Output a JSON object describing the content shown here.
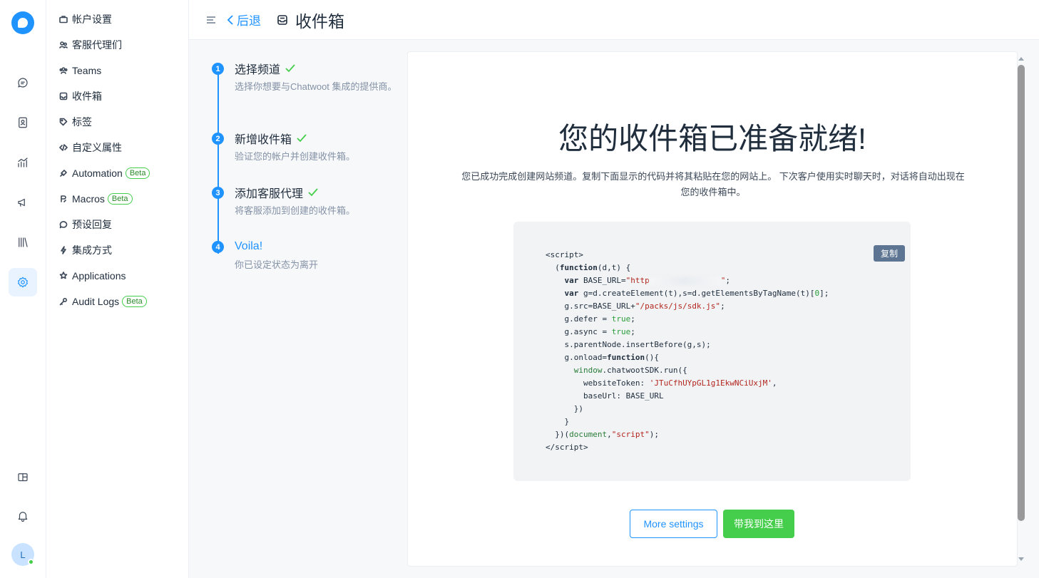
{
  "rail": {
    "avatar_initial": "L",
    "icons": [
      "conversations-icon",
      "contacts-icon",
      "reports-icon",
      "campaigns-icon",
      "library-icon",
      "settings-icon",
      "dashboard-apps-icon",
      "notifications-icon"
    ]
  },
  "sidebar": {
    "items": [
      {
        "label": "帐户设置",
        "icon": "briefcase-icon"
      },
      {
        "label": "客服代理们",
        "icon": "people-icon"
      },
      {
        "label": "Teams",
        "icon": "team-icon"
      },
      {
        "label": "收件箱",
        "icon": "inbox-icon"
      },
      {
        "label": "标签",
        "icon": "tag-icon"
      },
      {
        "label": "自定义属性",
        "icon": "code-icon"
      },
      {
        "label": "Automation",
        "icon": "automation-icon",
        "badge": "Beta"
      },
      {
        "label": "Macros",
        "icon": "macro-icon",
        "badge": "Beta"
      },
      {
        "label": "预设回复",
        "icon": "chat-icon"
      },
      {
        "label": "集成方式",
        "icon": "flash-icon"
      },
      {
        "label": "Applications",
        "icon": "star-icon"
      },
      {
        "label": "Audit Logs",
        "icon": "key-icon",
        "badge": "Beta"
      }
    ]
  },
  "header": {
    "back_label": "后退",
    "title": "收件箱"
  },
  "steps": [
    {
      "num": "1",
      "title": "选择频道",
      "desc": "选择你想要与Chatwoot 集成的提供商。",
      "done": true
    },
    {
      "num": "2",
      "title": "新增收件箱",
      "desc": "验证您的帐户并创建收件箱。",
      "done": true
    },
    {
      "num": "3",
      "title": "添加客服代理",
      "desc": "将客服添加到创建的收件箱。",
      "done": true
    },
    {
      "num": "4",
      "title": "Voila!",
      "desc": "你已设定状态为离开",
      "done": false
    }
  ],
  "main": {
    "title": "您的收件箱已准备就绪!",
    "description": "您已成功完成创建网站频道。复制下面显示的代码并将其粘贴在您的网站上。 下次客户使用实时聊天时，对话将自动出现在您的收件箱中。",
    "copy_label": "复制",
    "website_token": "JTuCfhUYpGL1g1EkwNCiUxjM",
    "more_settings_label": "More settings",
    "take_me_label": "带我到这里"
  },
  "colors": {
    "accent": "#1f93ff",
    "success": "#44ce4b",
    "copy_button": "#5d7592"
  }
}
